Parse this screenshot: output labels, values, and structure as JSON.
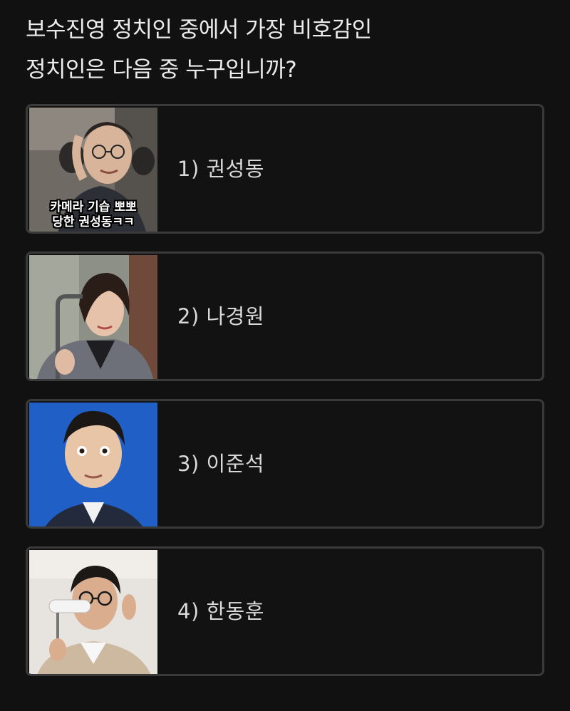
{
  "question": {
    "line1": "보수진영 정치인 중에서 가장 비호감인",
    "line2": "정치인은 다음 중 누구입니까?"
  },
  "options": [
    {
      "label": "1) 권성동",
      "image_caption_line1": "카메라 기습 뽀뽀",
      "image_caption_line2": "당한 권성동ㅋㅋ"
    },
    {
      "label": "2) 나경원"
    },
    {
      "label": "3) 이준석"
    },
    {
      "label": "4) 한동훈"
    }
  ],
  "colors": {
    "background": "#111111",
    "card_border": "#3a3a3a",
    "text": "#d9d9d9",
    "photo3_background": "#1f5fc6"
  }
}
